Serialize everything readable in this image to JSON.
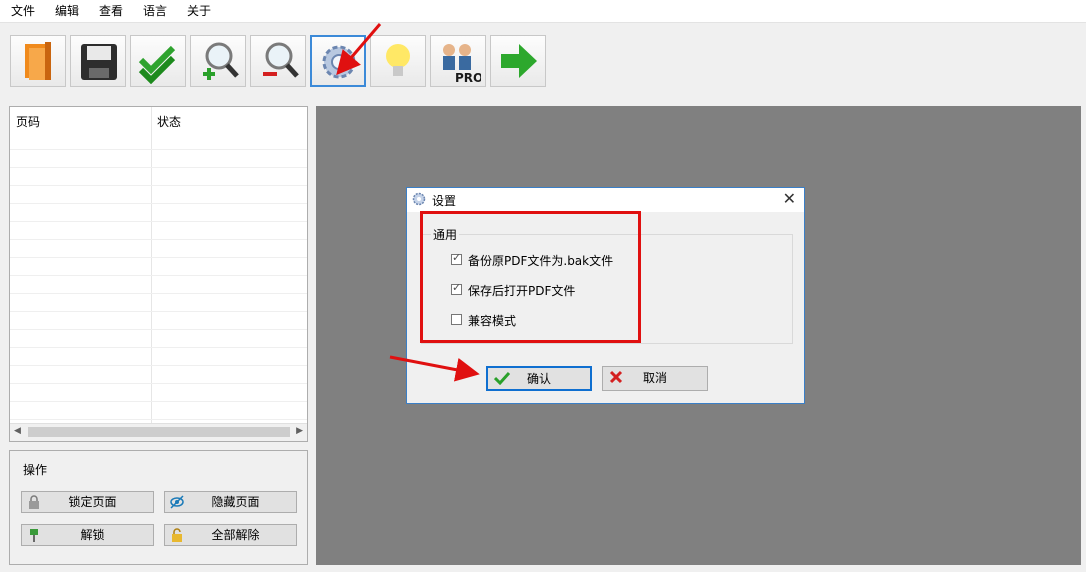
{
  "menu": [
    "文件",
    "编辑",
    "查看",
    "语言",
    "关于"
  ],
  "toolbar": {
    "buttons": [
      {
        "name": "open-icon"
      },
      {
        "name": "save-icon"
      },
      {
        "name": "check-icon"
      },
      {
        "name": "zoom-in-icon"
      },
      {
        "name": "zoom-out-icon"
      },
      {
        "name": "settings-gear-icon"
      },
      {
        "name": "bulb-icon"
      },
      {
        "name": "pro-users-icon",
        "text": "PRO"
      },
      {
        "name": "next-arrow-icon"
      }
    ]
  },
  "page_list": {
    "col_page": "页码",
    "col_status": "状态"
  },
  "ops": {
    "title": "操作",
    "lock_page": "锁定页面",
    "hide_page": "隐藏页面",
    "unlock": "解锁",
    "unlock_all": "全部解除"
  },
  "dialog": {
    "title": "设置",
    "group_title": "通用",
    "options": [
      {
        "label": "备份原PDF文件为.bak文件",
        "checked": true
      },
      {
        "label": "保存后打开PDF文件",
        "checked": true
      },
      {
        "label": "兼容模式",
        "checked": false
      }
    ],
    "ok_label": "确认",
    "cancel_label": "取消"
  },
  "colors": {
    "accent_border": "#3c8ad8",
    "highlight_red": "#e01010",
    "view_bg": "#808080"
  }
}
